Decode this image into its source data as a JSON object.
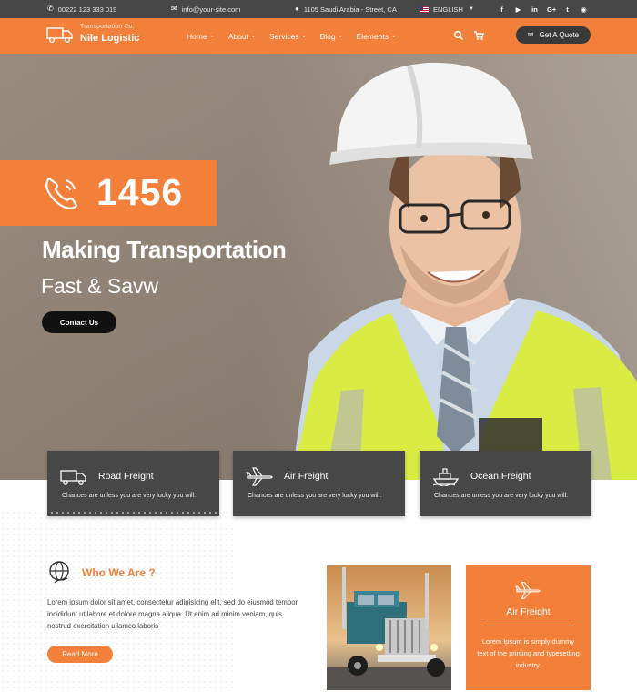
{
  "topbar": {
    "phone": "00222 123 333 019",
    "email": "info@your-site.com",
    "address": "1105 Saudi Arabia - Street, CA",
    "language": "ENGLISH",
    "socials": [
      "f",
      "youtube",
      "in",
      "G+",
      "twitter",
      "rss"
    ],
    "social_labels": [
      "f",
      "▶",
      "in",
      "G+",
      "t",
      "◉"
    ]
  },
  "header": {
    "logo_tagline": "Transportation Co.",
    "logo_name": "Nile Logistic",
    "nav": [
      "Home",
      "About",
      "Services",
      "Blog",
      "Elements"
    ],
    "quote_label": "Get A Quote"
  },
  "hero": {
    "phone_number": "1456",
    "title": "Making Transportation",
    "subtitle": "Fast & Savw",
    "cta": "Contact Us"
  },
  "services": [
    {
      "title": "Road Freight",
      "desc": "Chances are unless you are very lucky you will.",
      "icon": "truck-icon"
    },
    {
      "title": "Air Freight",
      "desc": "Chances are unless you are very lucky you will.",
      "icon": "airplane-icon"
    },
    {
      "title": "Ocean Freight",
      "desc": "Chances are unless you are very lucky you will.",
      "icon": "ship-icon"
    }
  ],
  "about": {
    "title": "Who We Are ?",
    "text": "Lorem ipsum dolor sit amet, consectetur adipisicing elit, sed do eiusmod tempor incididunt ut labore et dolore magna aliqua. Ut enim ad minim veniam, quis nostrud exercitation ullamco laboris",
    "button": "Read More"
  },
  "feature_box": {
    "title": "Air Freight",
    "text": "Lorem Ipsum is simply dummy text of the printing and typesetting industry."
  },
  "colors": {
    "accent": "#f2803a",
    "dark": "#474747",
    "topbar": "#474747"
  }
}
